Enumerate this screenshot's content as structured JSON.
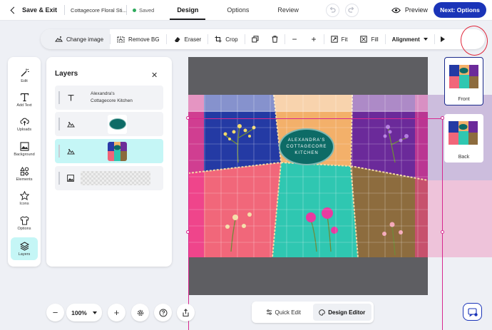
{
  "topbar": {
    "save_exit_label": "Save & Exit",
    "project_name": "Cottagecore Floral Sti...",
    "saved_label": "Saved",
    "tabs": [
      {
        "label": "Design",
        "active": true
      },
      {
        "label": "Options",
        "active": false
      },
      {
        "label": "Review",
        "active": false
      }
    ],
    "preview_label": "Preview",
    "next_label": "Next: Options"
  },
  "toolbar": {
    "change_image": "Change image",
    "remove_bg": "Remove BG",
    "eraser": "Eraser",
    "crop": "Crop",
    "fit": "Fit",
    "fill": "Fill",
    "alignment": "Alignment",
    "minus": "−",
    "plus": "+"
  },
  "tools": [
    {
      "label": "Edit",
      "icon": "magic-wand-icon"
    },
    {
      "label": "Add Text",
      "icon": "text-icon"
    },
    {
      "label": "Uploads",
      "icon": "cloud-upload-icon"
    },
    {
      "label": "Background",
      "icon": "background-icon"
    },
    {
      "label": "Elements",
      "icon": "shapes-icon"
    },
    {
      "label": "Icons",
      "icon": "star-icon"
    },
    {
      "label": "Options",
      "icon": "shirt-icon"
    },
    {
      "label": "Layers",
      "icon": "layers-icon",
      "active": true
    }
  ],
  "layers": {
    "title": "Layers",
    "close": "✕",
    "items": [
      {
        "type": "text",
        "line1": "Alexandra's",
        "line2": "Cottagecore Kitchen"
      },
      {
        "type": "shape"
      },
      {
        "type": "image",
        "selected": true
      },
      {
        "type": "background"
      }
    ]
  },
  "design": {
    "line1": "ALEXANDRA'S",
    "line2": "COTTAGECORE",
    "line3": "KITCHEN"
  },
  "sides": [
    {
      "label": "Front",
      "active": true
    },
    {
      "label": "Back",
      "active": false
    }
  ],
  "zoom": {
    "minus": "−",
    "value": "100%",
    "plus": "+"
  },
  "modes": {
    "quick_edit": "Quick Edit",
    "design_editor": "Design Editor"
  },
  "colors": {
    "accent": "#1a34b8",
    "selection": "#d8288f",
    "active_tool": "#c5f6f6",
    "oval": "#0d6b66"
  }
}
